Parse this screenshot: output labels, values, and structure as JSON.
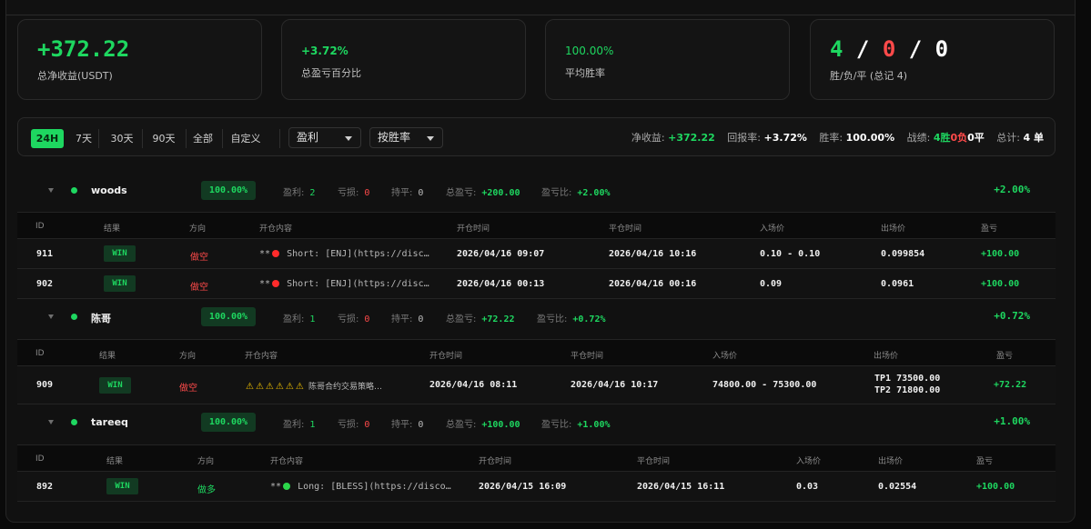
{
  "cards": [
    {
      "value": "+372.22",
      "label": "总净收益(USDT)"
    },
    {
      "value": "+3.72%",
      "label": "总盈亏百分比"
    },
    {
      "value": "100.00%",
      "label": "平均胜率"
    },
    {
      "win": "4",
      "loss": "0",
      "draw": "0",
      "sep": "/",
      "label": "胜/负/平 (总记 4)"
    }
  ],
  "filter": {
    "ranges": [
      "24H",
      "7天",
      "30天",
      "90天",
      "全部",
      "自定义"
    ],
    "active_range": "24H",
    "sort_select": "盈利",
    "order_select": "按胜率"
  },
  "summary": {
    "net_label": "净收益:",
    "net_value": "+372.22",
    "return_label": "回报率:",
    "return_value": "+3.72%",
    "winrate_label": "胜率:",
    "winrate_value": "100.00%",
    "record_label": "战绩:",
    "record_win": "4胜",
    "record_loss": "0负",
    "record_draw": "0平",
    "total_label": "总计:",
    "total_value": "4 单"
  },
  "columns": [
    "ID",
    "结果",
    "方向",
    "开仓内容",
    "开仓时间",
    "平仓时间",
    "入场价",
    "出场价",
    "盈亏"
  ],
  "groups": [
    {
      "name": "woods",
      "winrate": "100.00%",
      "profit_label": "盈利:",
      "profit": "2",
      "loss_label": "亏损:",
      "loss": "0",
      "draw_label": "持平:",
      "draw": "0",
      "total_label": "总盈亏:",
      "total": "+200.00",
      "ratio_label": "盈亏比:",
      "ratio": "+2.00%",
      "right_pct": "+2.00%",
      "rows": [
        {
          "id": "911",
          "result": "WIN",
          "direction": "做空",
          "content_prefix": "**",
          "content": "Short: [ENJ](https://disc…",
          "open": "2026/04/16 09:07",
          "close": "2026/04/16 10:16",
          "entry": "0.10 - 0.10",
          "exit": "0.099854",
          "pnl": "+100.00"
        },
        {
          "id": "902",
          "result": "WIN",
          "direction": "做空",
          "content_prefix": "**",
          "content": "Short: [ENJ](https://disc…",
          "open": "2026/04/16 00:13",
          "close": "2026/04/16 00:16",
          "entry": "0.09",
          "exit": "0.0961",
          "pnl": "+100.00"
        }
      ]
    },
    {
      "name": "陈哥",
      "winrate": "100.00%",
      "profit_label": "盈利:",
      "profit": "1",
      "loss_label": "亏损:",
      "loss": "0",
      "draw_label": "持平:",
      "draw": "0",
      "total_label": "总盈亏:",
      "total": "+72.22",
      "ratio_label": "盈亏比:",
      "ratio": "+0.72%",
      "right_pct": "+0.72%",
      "rows": [
        {
          "id": "909",
          "result": "WIN",
          "direction": "做空",
          "content_warn": "⚠⚠⚠⚠⚠⚠",
          "content": "陈哥合约交易策略…",
          "open": "2026/04/16 08:11",
          "close": "2026/04/16 10:17",
          "entry": "74800.00 - 75300.00",
          "exit_1": "TP1 73500.00",
          "exit_2": "TP2 71800.00",
          "pnl": "+72.22"
        }
      ]
    },
    {
      "name": "tareeq",
      "winrate": "100.00%",
      "profit_label": "盈利:",
      "profit": "1",
      "loss_label": "亏损:",
      "loss": "0",
      "draw_label": "持平:",
      "draw": "0",
      "total_label": "总盈亏:",
      "total": "+100.00",
      "ratio_label": "盈亏比:",
      "ratio": "+1.00%",
      "right_pct": "+1.00%",
      "rows": [
        {
          "id": "892",
          "result": "WIN",
          "direction": "做多",
          "content_prefix": "**",
          "content": "Long: [BLESS](https://disco…",
          "open": "2026/04/15 16:09",
          "close": "2026/04/15 16:11",
          "entry": "0.03",
          "exit": "0.02554",
          "pnl": "+100.00"
        }
      ]
    }
  ],
  "colors": {
    "accent": "#1ed760",
    "loss": "#ff4a4a",
    "background": "#0a0a0a",
    "card": "#141414"
  }
}
